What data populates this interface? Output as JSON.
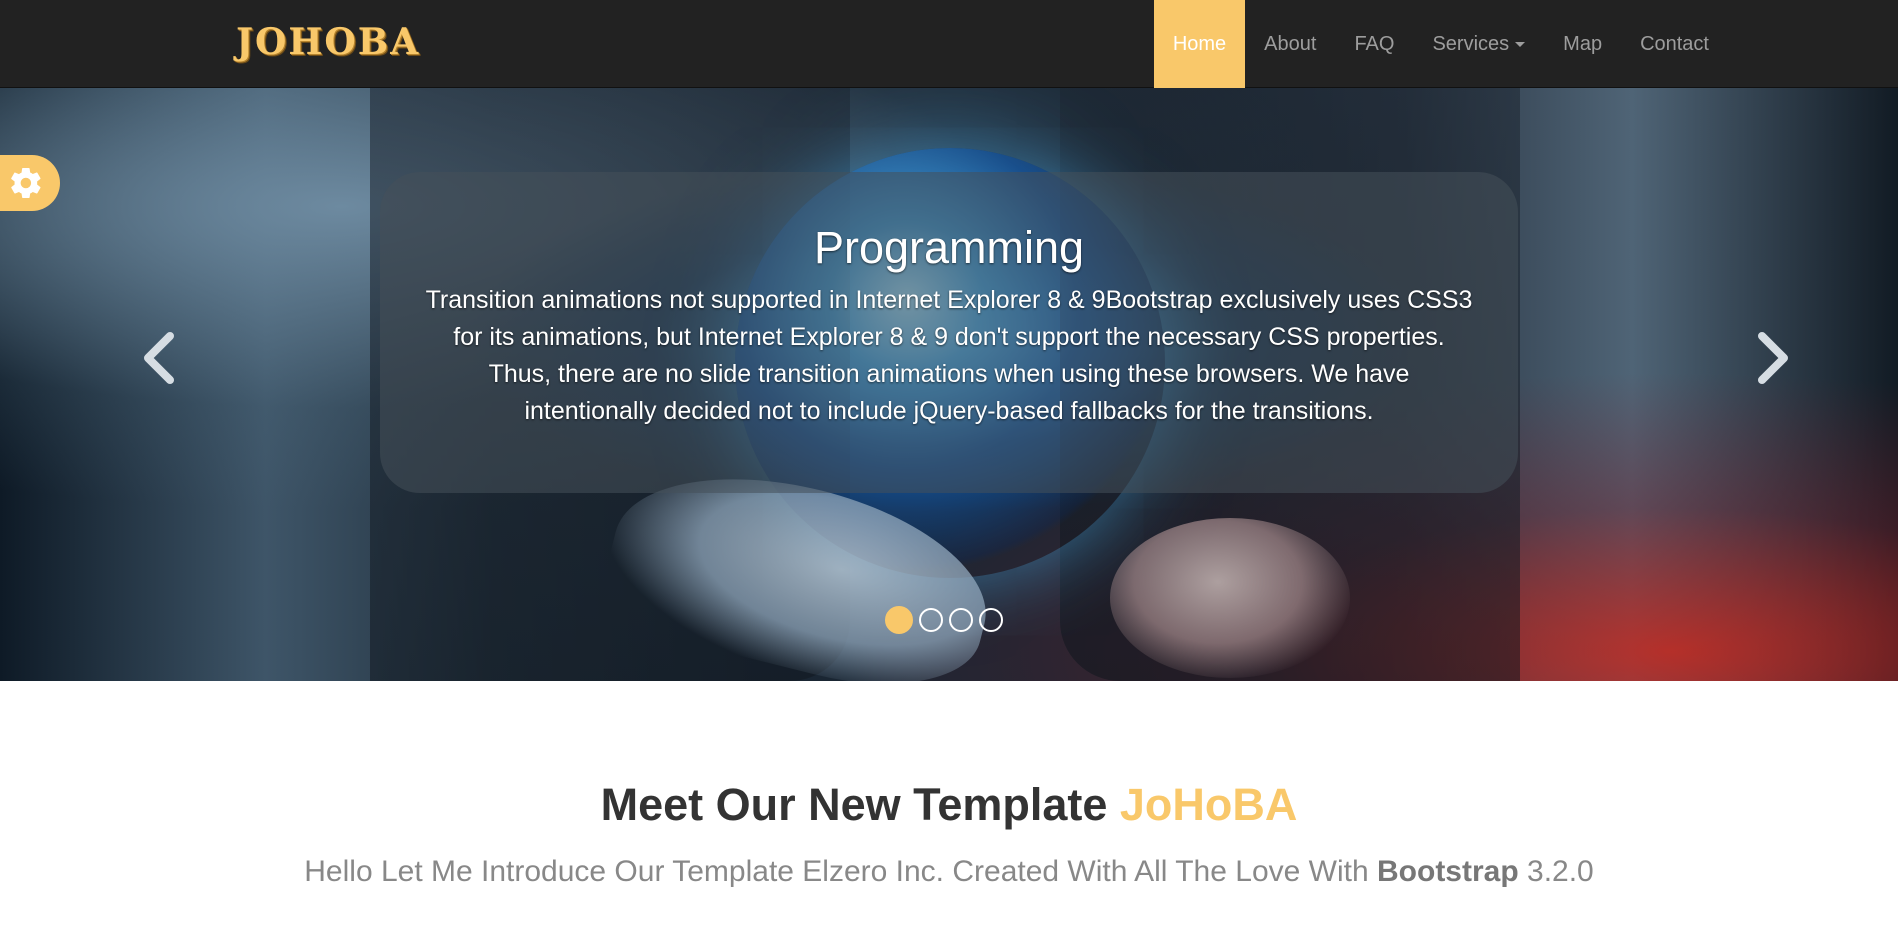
{
  "navbar": {
    "brand": "JOHOBA",
    "items": [
      {
        "label": "Home",
        "active": true
      },
      {
        "label": "About"
      },
      {
        "label": "FAQ"
      },
      {
        "label": "Services",
        "dropdown": true
      },
      {
        "label": "Map"
      },
      {
        "label": "Contact"
      }
    ]
  },
  "carousel": {
    "slide": {
      "title": "Programming",
      "text": "Transition animations not supported in Internet Explorer 8 & 9Bootstrap exclusively uses CSS3 for its animations, but Internet Explorer 8 & 9 don't support the necessary CSS properties. Thus, there are no slide transition animations when using these browsers. We have intentionally decided not to include jQuery-based fallbacks for the transitions."
    },
    "indicator_count": 4,
    "active_indicator": 1,
    "prev_icon": "chevron-left-icon",
    "next_icon": "chevron-right-icon"
  },
  "settings_tab": {
    "icon": "gear-icon"
  },
  "intro": {
    "heading_prefix": "Meet Our New Template ",
    "heading_accent": "JoHoBA",
    "subtitle_prefix": "Hello Let Me Introduce Our Template Elzero Inc. Created With All The Love With ",
    "subtitle_bold": "Bootstrap",
    "subtitle_suffix": " 3.2.0"
  },
  "colors": {
    "accent": "#f9c86a",
    "navbar_bg": "#222222",
    "nav_text": "#9d9d9d"
  }
}
